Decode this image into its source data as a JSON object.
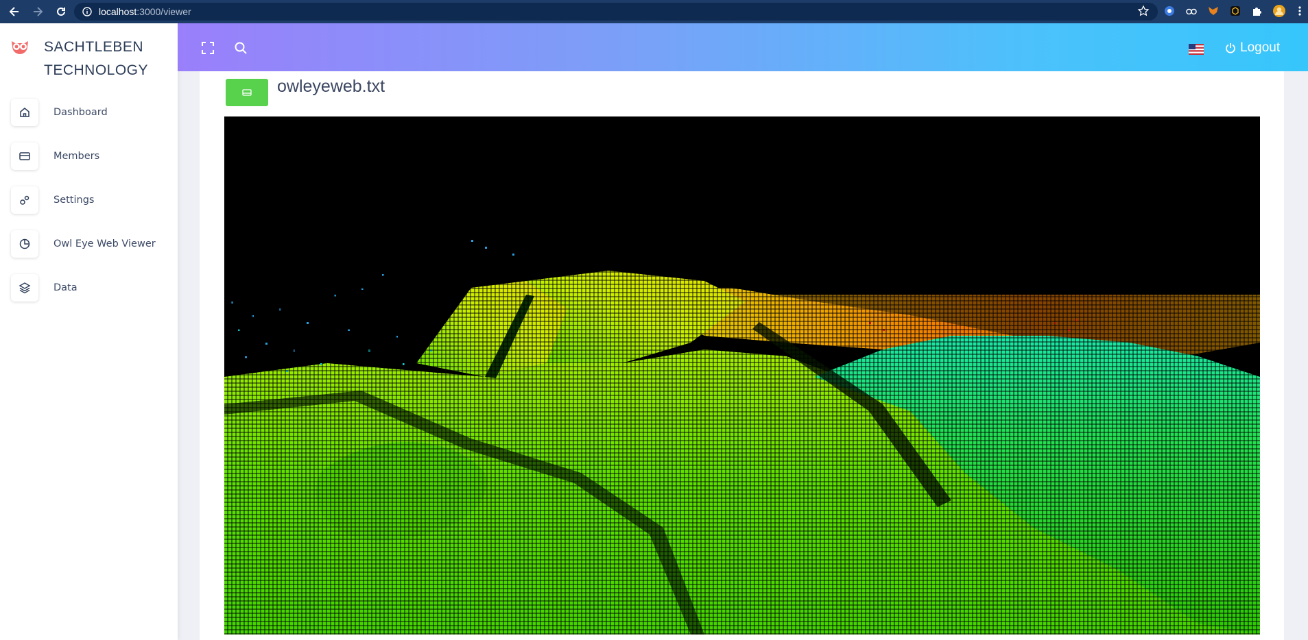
{
  "browser": {
    "url_host": "localhost",
    "url_path": ":3000/viewer"
  },
  "sidebar": {
    "brand_line1": "SACHTLEBEN",
    "brand_line2": "TECHNOLOGY",
    "items": [
      {
        "label": "Dashboard",
        "icon": "home-icon"
      },
      {
        "label": "Members",
        "icon": "credit-card-icon"
      },
      {
        "label": "Settings",
        "icon": "gears-icon"
      },
      {
        "label": "Owl Eye Web Viewer",
        "icon": "pie-chart-icon"
      },
      {
        "label": "Data",
        "icon": "layers-icon"
      }
    ]
  },
  "header": {
    "logout_label": "Logout",
    "language_icon": "us-flag-icon"
  },
  "main": {
    "file_name": "owleyeweb.txt"
  },
  "colors": {
    "header_gradient_start": "#9a7ffb",
    "header_gradient_end": "#36c6fb",
    "file_button": "#58d24c",
    "viewer_background": "#000000"
  }
}
